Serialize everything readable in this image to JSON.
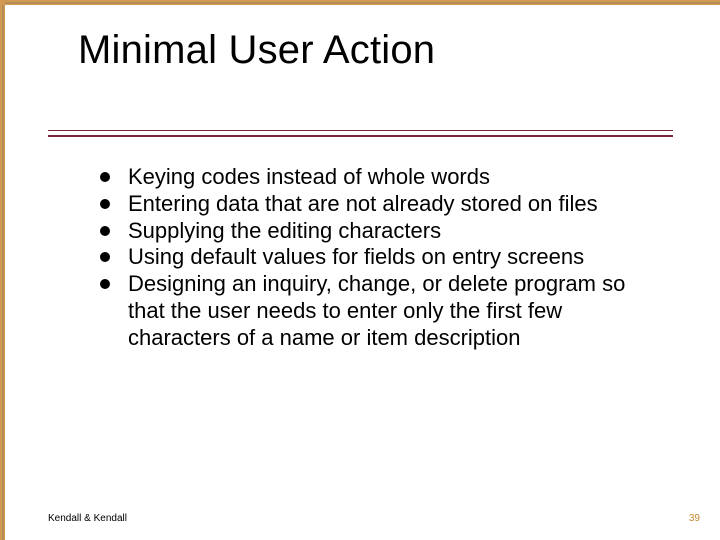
{
  "slide": {
    "title": "Minimal User Action",
    "bullets": [
      "Keying codes instead of whole words",
      "Entering data that are not already stored on files",
      "Supplying the editing characters",
      "Using default values for fields on entry screens",
      "Designing an inquiry, change, or delete program so that the user needs to enter only the first few characters of a name or item description"
    ],
    "footer_left": "Kendall & Kendall",
    "page_number": "39"
  }
}
